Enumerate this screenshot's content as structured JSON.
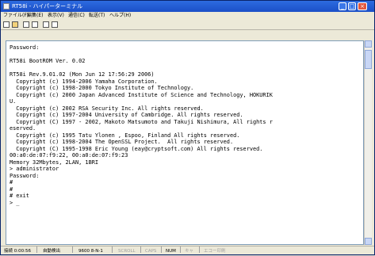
{
  "window": {
    "title": "RT58i - ハイパーターミナル"
  },
  "menu": [
    "ファイル(F)",
    "編集(E)",
    "表示(V)",
    "通信(C)",
    "転送(T)",
    "ヘルプ(H)"
  ],
  "toolbar_icons": [
    "new-icon",
    "open-icon",
    "phone-icon",
    "disconnect-icon",
    "send-icon",
    "properties-icon"
  ],
  "terminal": {
    "lines": [
      "Password:",
      "",
      "RT58i BootROM Ver. 0.02",
      "",
      "RT58i Rev.9.01.02 (Mon Jun 12 17:56:29 2006)",
      "  Copyright (c) 1994-2006 Yamaha Corporation.",
      "  Copyright (c) 1998-2000 Tokyo Institute of Technology.",
      "  Copyright (c) 2000 Japan Advanced Institute of Science and Technology, HOKURIK",
      "U.",
      "  Copyright (c) 2002 RSA Security Inc. All rights reserved.",
      "  Copyright (c) 1997-2004 University of Cambridge. All rights reserved.",
      "  Copyright (C) 1997 - 2002, Makoto Matsumoto and Takuji Nishimura, All rights r",
      "eserved.",
      "  Copyright (c) 1995 Tatu Ylonen , Espoo, Finland All rights reserved.",
      "  Copyright (c) 1998-2004 The OpenSSL Project.  All rights reserved.",
      "  Copyright (C) 1995-1998 Eric Young (eay@cryptsoft.com) All rights reserved.",
      "00:a0:de:07:f9:22, 00:a0:de:07:f9:23",
      "Memory 32Mbytes, 2LAN, 1BRI",
      "> administrator",
      "Password:",
      "#",
      "#",
      "# exit",
      "> _"
    ]
  },
  "status": {
    "time": "接続 0:00:56",
    "detect": "自動検出",
    "settings": "9600 8-N-1",
    "scroll": "SCROLL",
    "caps": "CAPS",
    "num": "NUM",
    "capture": "キャ",
    "echo": "エコー印刷"
  }
}
